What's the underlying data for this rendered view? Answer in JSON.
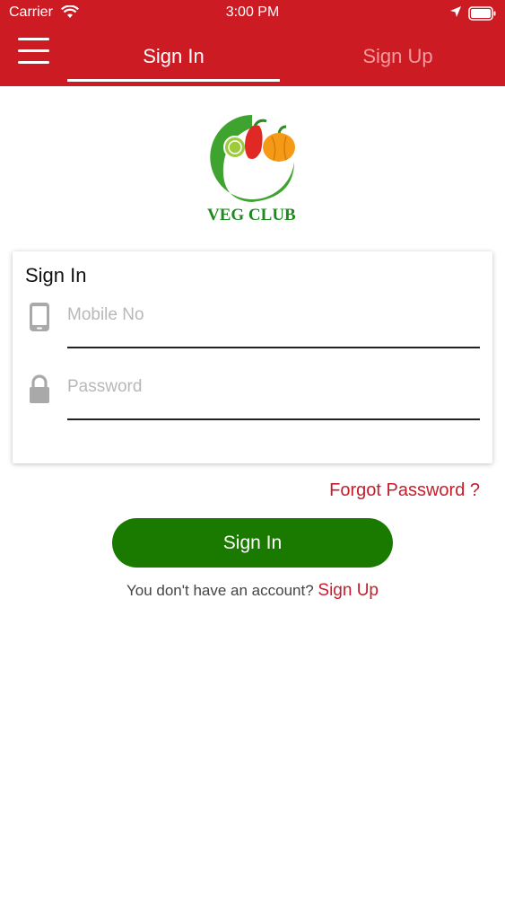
{
  "status_bar": {
    "carrier": "Carrier",
    "time": "3:00 PM"
  },
  "header": {
    "menu_icon": "hamburger-menu-icon",
    "tabs": [
      {
        "label": "Sign In",
        "active": true
      },
      {
        "label": "Sign Up",
        "active": false
      }
    ]
  },
  "logo": {
    "text": "VEG CLUB",
    "accent": "#1e8a1e"
  },
  "form": {
    "title": "Sign In",
    "mobile": {
      "placeholder": "Mobile No",
      "value": "",
      "icon": "mobile-phone-icon"
    },
    "password": {
      "placeholder": "Password",
      "value": "",
      "icon": "lock-icon"
    }
  },
  "forgot_password": "Forgot Password ?",
  "signin_button": "Sign In",
  "account_prompt": {
    "text": "You don't have an account?",
    "link": "Sign Up"
  },
  "colors": {
    "header": "#cd1b24",
    "button": "#1a7a00",
    "link": "#c51d2b"
  }
}
